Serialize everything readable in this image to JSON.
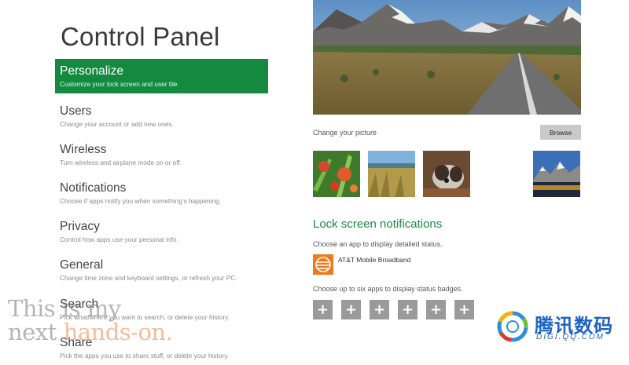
{
  "page": {
    "title": "Control Panel"
  },
  "menu": [
    {
      "title": "Personalize",
      "desc": "Customize your lock screen and user tile.",
      "active": true
    },
    {
      "title": "Users",
      "desc": "Change your account or add new ones."
    },
    {
      "title": "Wireless",
      "desc": "Turn wireless and airplane mode on or off."
    },
    {
      "title": "Notifications",
      "desc": "Choose if apps notify you when something's happening."
    },
    {
      "title": "Privacy",
      "desc": "Control how apps use your personal info."
    },
    {
      "title": "General",
      "desc": "Change time zone and keyboard settings, or refresh your PC."
    },
    {
      "title": "Search",
      "desc": "Pick what/where you want to search, or delete your history."
    },
    {
      "title": "Share",
      "desc": "Pick the apps you use to share stuff, or delete your history."
    }
  ],
  "lock_screen": {
    "change_picture_label": "Change your picture",
    "browse_label": "Browse",
    "thumbnails": [
      "flowers",
      "grassland",
      "dog",
      "mountains"
    ]
  },
  "notifications": {
    "title": "Lock screen notifications",
    "detailed_status_label": "Choose an app to display detailed status.",
    "app_name": "AT&T Mobile Broadband",
    "badges_label": "Choose up to six apps to display status badges.",
    "slot_symbol": "+"
  },
  "watermark": {
    "line1": "This is my",
    "line2a": "next ",
    "line2b": "hands-on."
  },
  "logo": {
    "cn": "腾讯数码",
    "en": "DIGI.QQ.COM"
  },
  "colors": {
    "accent": "#138a3f",
    "section_title": "#1a8a45",
    "badge_slot": "#9a9a9a",
    "app_icon": "#f07a1a"
  }
}
